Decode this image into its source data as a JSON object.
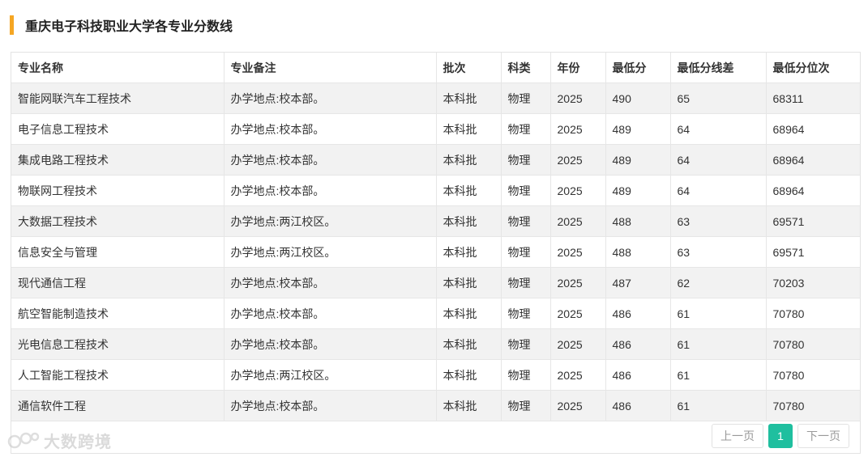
{
  "title": "重庆电子科技职业大学各专业分数线",
  "table": {
    "headers": [
      "专业名称",
      "专业备注",
      "批次",
      "科类",
      "年份",
      "最低分",
      "最低分线差",
      "最低分位次"
    ],
    "rows": [
      [
        "智能网联汽车工程技术",
        "办学地点:校本部。",
        "本科批",
        "物理",
        "2025",
        "490",
        "65",
        "68311"
      ],
      [
        "电子信息工程技术",
        "办学地点:校本部。",
        "本科批",
        "物理",
        "2025",
        "489",
        "64",
        "68964"
      ],
      [
        "集成电路工程技术",
        "办学地点:校本部。",
        "本科批",
        "物理",
        "2025",
        "489",
        "64",
        "68964"
      ],
      [
        "物联网工程技术",
        "办学地点:校本部。",
        "本科批",
        "物理",
        "2025",
        "489",
        "64",
        "68964"
      ],
      [
        "大数据工程技术",
        "办学地点:两江校区。",
        "本科批",
        "物理",
        "2025",
        "488",
        "63",
        "69571"
      ],
      [
        "信息安全与管理",
        "办学地点:两江校区。",
        "本科批",
        "物理",
        "2025",
        "488",
        "63",
        "69571"
      ],
      [
        "现代通信工程",
        "办学地点:校本部。",
        "本科批",
        "物理",
        "2025",
        "487",
        "62",
        "70203"
      ],
      [
        "航空智能制造技术",
        "办学地点:校本部。",
        "本科批",
        "物理",
        "2025",
        "486",
        "61",
        "70780"
      ],
      [
        "光电信息工程技术",
        "办学地点:校本部。",
        "本科批",
        "物理",
        "2025",
        "486",
        "61",
        "70780"
      ],
      [
        "人工智能工程技术",
        "办学地点:两江校区。",
        "本科批",
        "物理",
        "2025",
        "486",
        "61",
        "70780"
      ],
      [
        "通信软件工程",
        "办学地点:校本部。",
        "本科批",
        "物理",
        "2025",
        "486",
        "61",
        "70780"
      ]
    ]
  },
  "pagination": {
    "prev_label": "上一页",
    "current_page": "1",
    "next_label": "下一页"
  },
  "watermark": {
    "text": "大数跨境",
    "icon": "brand-logo-icon"
  },
  "colors": {
    "accent_bar": "#f5a623",
    "active_page": "#1fbf9f",
    "stripe": "#f2f2f2"
  }
}
